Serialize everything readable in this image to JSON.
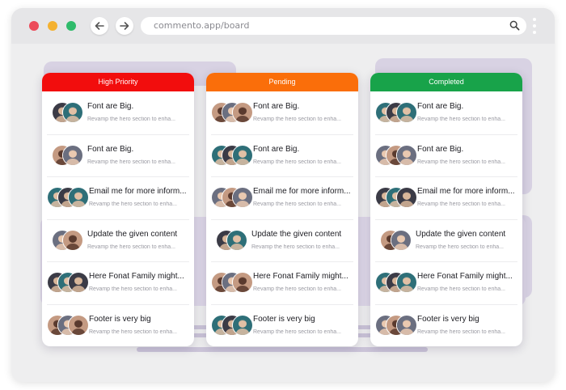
{
  "browser": {
    "url": "commento.app/board"
  },
  "colors": {
    "high_priority": "#f20d0d",
    "pending": "#fa6e0a",
    "completed": "#18a34a"
  },
  "columns": [
    {
      "label": "High Priority",
      "cards": [
        {
          "title": "Font are Big.",
          "subtitle": "Revamp the hero section to enha...",
          "avatars": 2
        },
        {
          "title": "Font are Big.",
          "subtitle": "Revamp the hero section to enha...",
          "avatars": 2
        },
        {
          "title": "Email me for more inform...",
          "subtitle": "Revamp the hero section to enha...",
          "avatars": 3
        },
        {
          "title": "Update the given content",
          "subtitle": "Revamp the hero section to enha...",
          "avatars": 2
        },
        {
          "title": "Here Fonat Family might...",
          "subtitle": "Revamp the hero section to enha...",
          "avatars": 3
        },
        {
          "title": "Footer is very big",
          "subtitle": "Revamp the hero section to enha...",
          "avatars": 3
        }
      ]
    },
    {
      "label": "Pending",
      "cards": [
        {
          "title": "Font are Big.",
          "subtitle": "Revamp the hero section to enha...",
          "avatars": 3
        },
        {
          "title": "Font are Big.",
          "subtitle": "Revamp the hero section to enha...",
          "avatars": 3
        },
        {
          "title": "Email me for more inform...",
          "subtitle": "Revamp the hero section to enha...",
          "avatars": 3
        },
        {
          "title": "Update the given content",
          "subtitle": "Revamp the hero section to enha...",
          "avatars": 2
        },
        {
          "title": "Here Fonat Family might...",
          "subtitle": "Revamp the hero section to enha...",
          "avatars": 3
        },
        {
          "title": "Footer is very big",
          "subtitle": "Revamp the hero section to enha...",
          "avatars": 3
        }
      ]
    },
    {
      "label": "Completed",
      "cards": [
        {
          "title": "Font are Big.",
          "subtitle": "Revamp the hero section to enha...",
          "avatars": 3
        },
        {
          "title": "Font are Big.",
          "subtitle": "Revamp the hero section to enha...",
          "avatars": 3
        },
        {
          "title": "Email me for more inform...",
          "subtitle": "Revamp the hero section to enha...",
          "avatars": 3
        },
        {
          "title": "Update the given content",
          "subtitle": "Revamp the hero section to enha...",
          "avatars": 2
        },
        {
          "title": "Here Fonat Family might...",
          "subtitle": "Revamp the hero section to enha...",
          "avatars": 3
        },
        {
          "title": "Footer is very big",
          "subtitle": "Revamp the hero section to enha...",
          "avatars": 3
        }
      ]
    }
  ]
}
